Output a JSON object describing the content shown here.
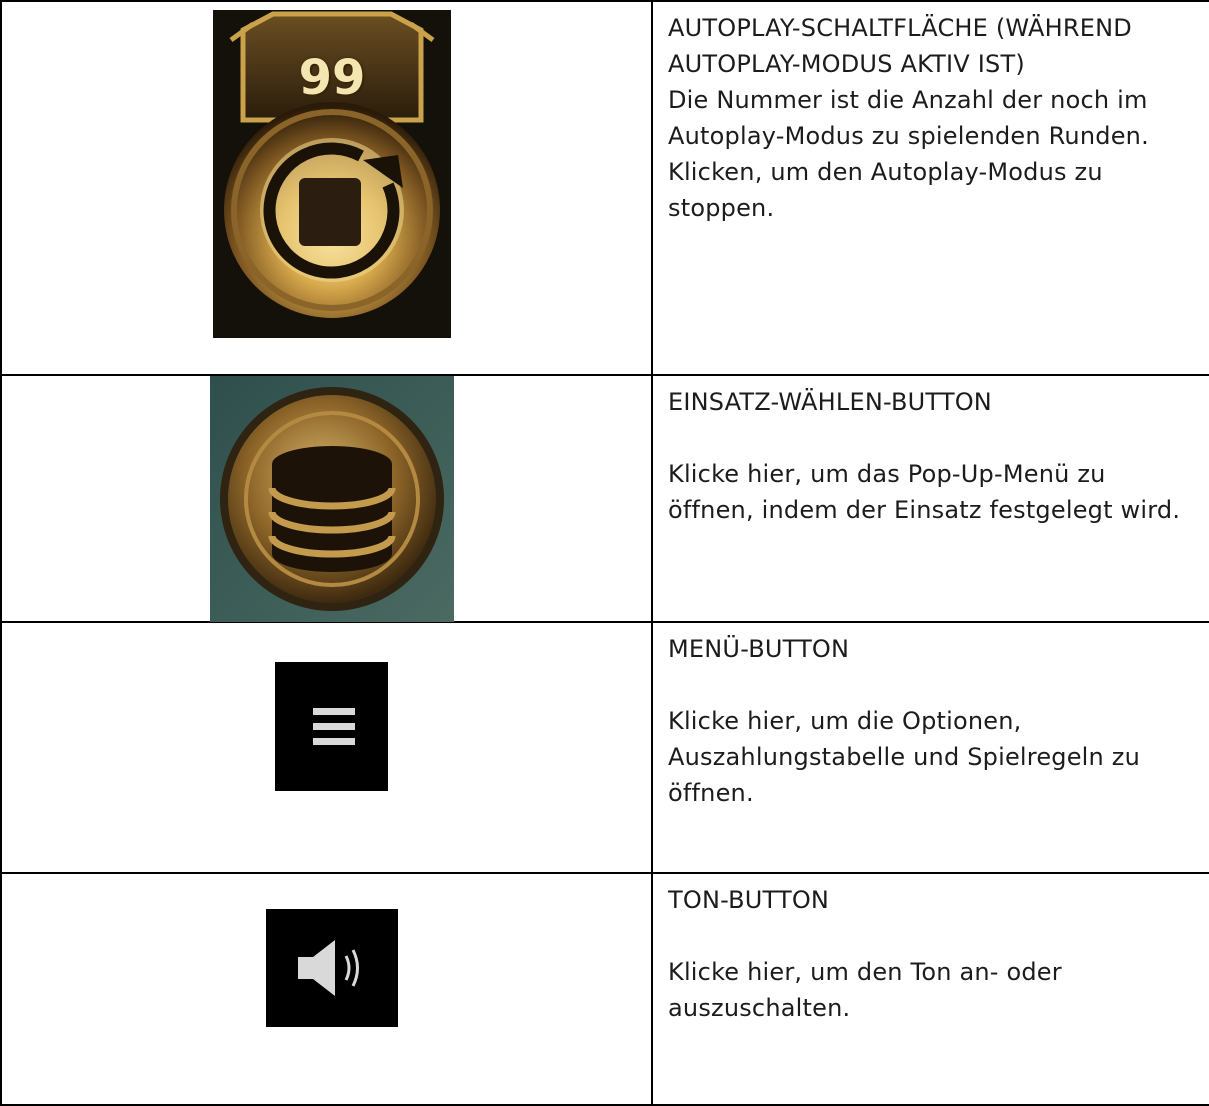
{
  "rows": [
    {
      "icon": "autoplay-stop-icon",
      "counter": "99",
      "title": "AUTOPLAY-SCHALTFLÄCHE (WÄHREND AUTOPLAY-MODUS AKTIV IST)",
      "description": "Die Nummer ist die Anzahl der noch im Autoplay-Modus zu spielenden Runden. Klicken, um den Autoplay-Modus zu stoppen."
    },
    {
      "icon": "coin-stack-icon",
      "title": "EINSATZ-WÄHLEN-BUTTON",
      "description": "Klicke hier, um das Pop-Up-Menü zu öffnen, indem der Einsatz festgelegt wird."
    },
    {
      "icon": "menu-icon",
      "title": "MENÜ-BUTTON",
      "description": "Klicke hier, um die Optionen, Auszahlungstabelle und Spielregeln zu öffnen."
    },
    {
      "icon": "speaker-icon",
      "title": "TON-BUTTON",
      "description": "Klicke hier, um den Ton an- oder auszuschalten."
    }
  ],
  "colors": {
    "gold": "#c9a24a",
    "bronze": "#6b4a1c",
    "icon_bg": "#000000",
    "icon_fg": "#d9d9d9"
  }
}
